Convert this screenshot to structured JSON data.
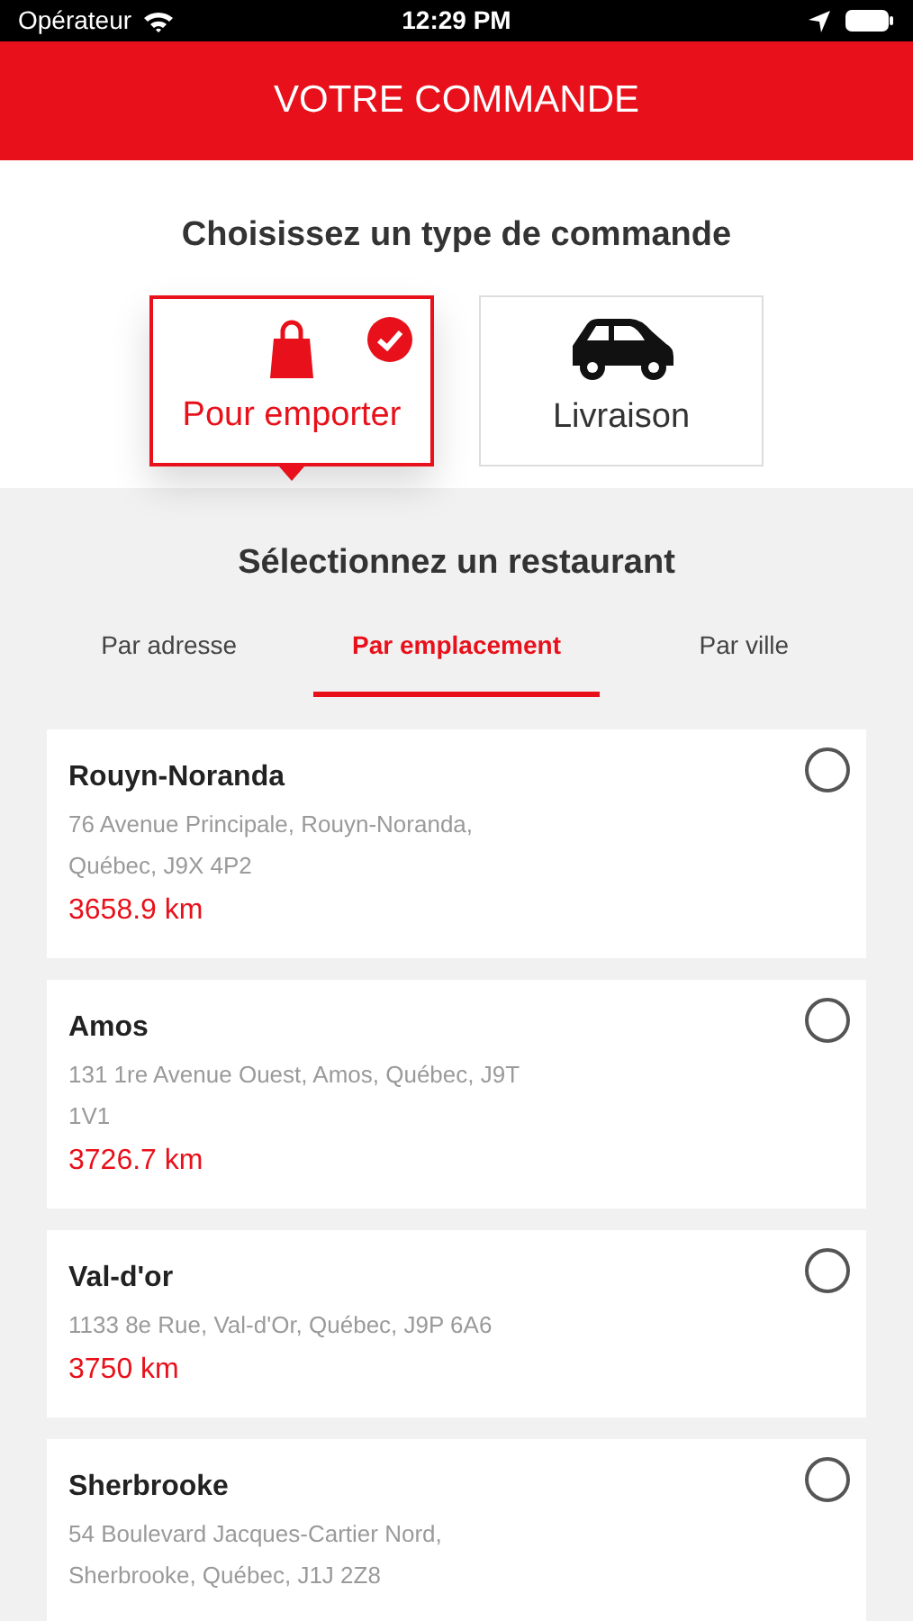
{
  "status_bar": {
    "carrier": "Opérateur",
    "time": "12:29 PM"
  },
  "header": {
    "title": "VOTRE COMMANDE"
  },
  "order_type": {
    "title": "Choisissez un type de commande",
    "options": [
      {
        "kind": "takeaway",
        "label": "Pour emporter",
        "selected": true
      },
      {
        "kind": "delivery",
        "label": "Livraison",
        "selected": false
      }
    ]
  },
  "restaurants": {
    "title": "Sélectionnez un restaurant",
    "tabs": [
      {
        "label": "Par adresse",
        "selected": false
      },
      {
        "label": "Par emplacement",
        "selected": true
      },
      {
        "label": "Par ville",
        "selected": false
      }
    ],
    "items": [
      {
        "name": "Rouyn-Noranda",
        "address": "76 Avenue Principale, Rouyn-Noranda, Québec, J9X 4P2",
        "distance": "3658.9 km",
        "selected": false
      },
      {
        "name": "Amos",
        "address": "131 1re Avenue Ouest, Amos, Québec, J9T 1V1",
        "distance": "3726.7 km",
        "selected": false
      },
      {
        "name": "Val-d'or",
        "address": "1133 8e Rue, Val-d'Or, Québec, J9P 6A6",
        "distance": "3750 km",
        "selected": false
      },
      {
        "name": "Sherbrooke",
        "address": "54 Boulevard Jacques-Cartier Nord, Sherbrooke, Québec, J1J 2Z8",
        "selected": false
      }
    ]
  }
}
